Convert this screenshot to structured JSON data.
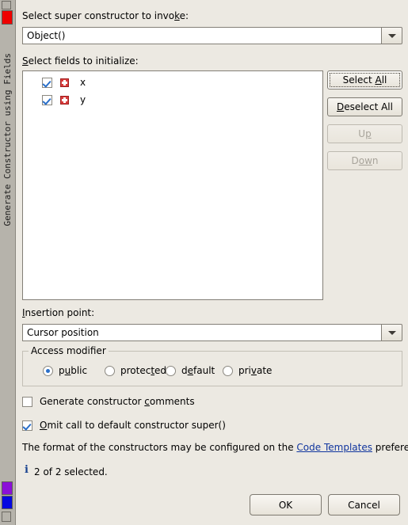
{
  "window": {
    "rail_label": "Generate Constructor using Fields",
    "rail_top_icon": "minimize-icon",
    "rail_red_icon": "red-marker-icon",
    "rail_purple_icon": "purple-marker-icon",
    "rail_blue_icon": "blue-marker-icon",
    "rail_bottom_icon": "restore-icon"
  },
  "super_constructor": {
    "label_pre": "Select super constructor to invo",
    "label_mnemonic": "k",
    "label_post": "e:",
    "value": "Object()",
    "dropdown_icon": "chevron-down-icon"
  },
  "fields": {
    "label_mnemonic": "S",
    "label_post": "elect fields to initialize:",
    "items": [
      {
        "name": "x",
        "checked": true,
        "icon": "public-field-icon"
      },
      {
        "name": "y",
        "checked": true,
        "icon": "public-field-icon"
      }
    ],
    "buttons": [
      {
        "id": "select-all",
        "pre": "Select ",
        "mnemonic": "A",
        "post": "ll",
        "enabled": true,
        "focused": true
      },
      {
        "id": "deselect-all",
        "pre": "",
        "mnemonic": "D",
        "post": "eselect All",
        "enabled": true,
        "focused": false
      },
      {
        "id": "up",
        "pre": "U",
        "mnemonic": "p",
        "post": "",
        "enabled": false,
        "focused": false
      },
      {
        "id": "down",
        "pre": "D",
        "mnemonic": "ow",
        "post": "n",
        "enabled": false,
        "focused": false
      }
    ]
  },
  "insertion_point": {
    "label_mnemonic": "I",
    "label_post": "nsertion point:",
    "value": "Cursor position",
    "dropdown_icon": "chevron-down-icon"
  },
  "access_modifier": {
    "group_title": "Access modifier",
    "options": [
      {
        "id": "public",
        "pre": "p",
        "mnemonic": "u",
        "post": "blic",
        "selected": true
      },
      {
        "id": "protected",
        "pre": "protec",
        "mnemonic": "t",
        "post": "ed",
        "selected": false
      },
      {
        "id": "default",
        "pre": "d",
        "mnemonic": "e",
        "post": "fault",
        "selected": false
      },
      {
        "id": "private",
        "pre": "pri",
        "mnemonic": "v",
        "post": "ate",
        "selected": false
      }
    ]
  },
  "options": {
    "generate_comments": {
      "pre": "Generate constructor ",
      "mnemonic": "c",
      "post": "omments",
      "checked": false
    },
    "omit_super": {
      "pre": "",
      "mnemonic": "O",
      "post": "mit call to default constructor super()",
      "checked": true
    }
  },
  "hint": {
    "before": "The format of the constructors may be configured on the ",
    "link": "Code Templates",
    "after": " preference page."
  },
  "status": {
    "icon": "info-icon",
    "text": "2 of 2 selected."
  },
  "footer": {
    "ok_label": "OK",
    "cancel_label": "Cancel"
  },
  "colors": {
    "background": "#ece9e2",
    "rail": "#b6b3ab",
    "accent_blue": "#2a6fc9",
    "link": "#10359e",
    "field_icon_red": "#d83b3b"
  }
}
